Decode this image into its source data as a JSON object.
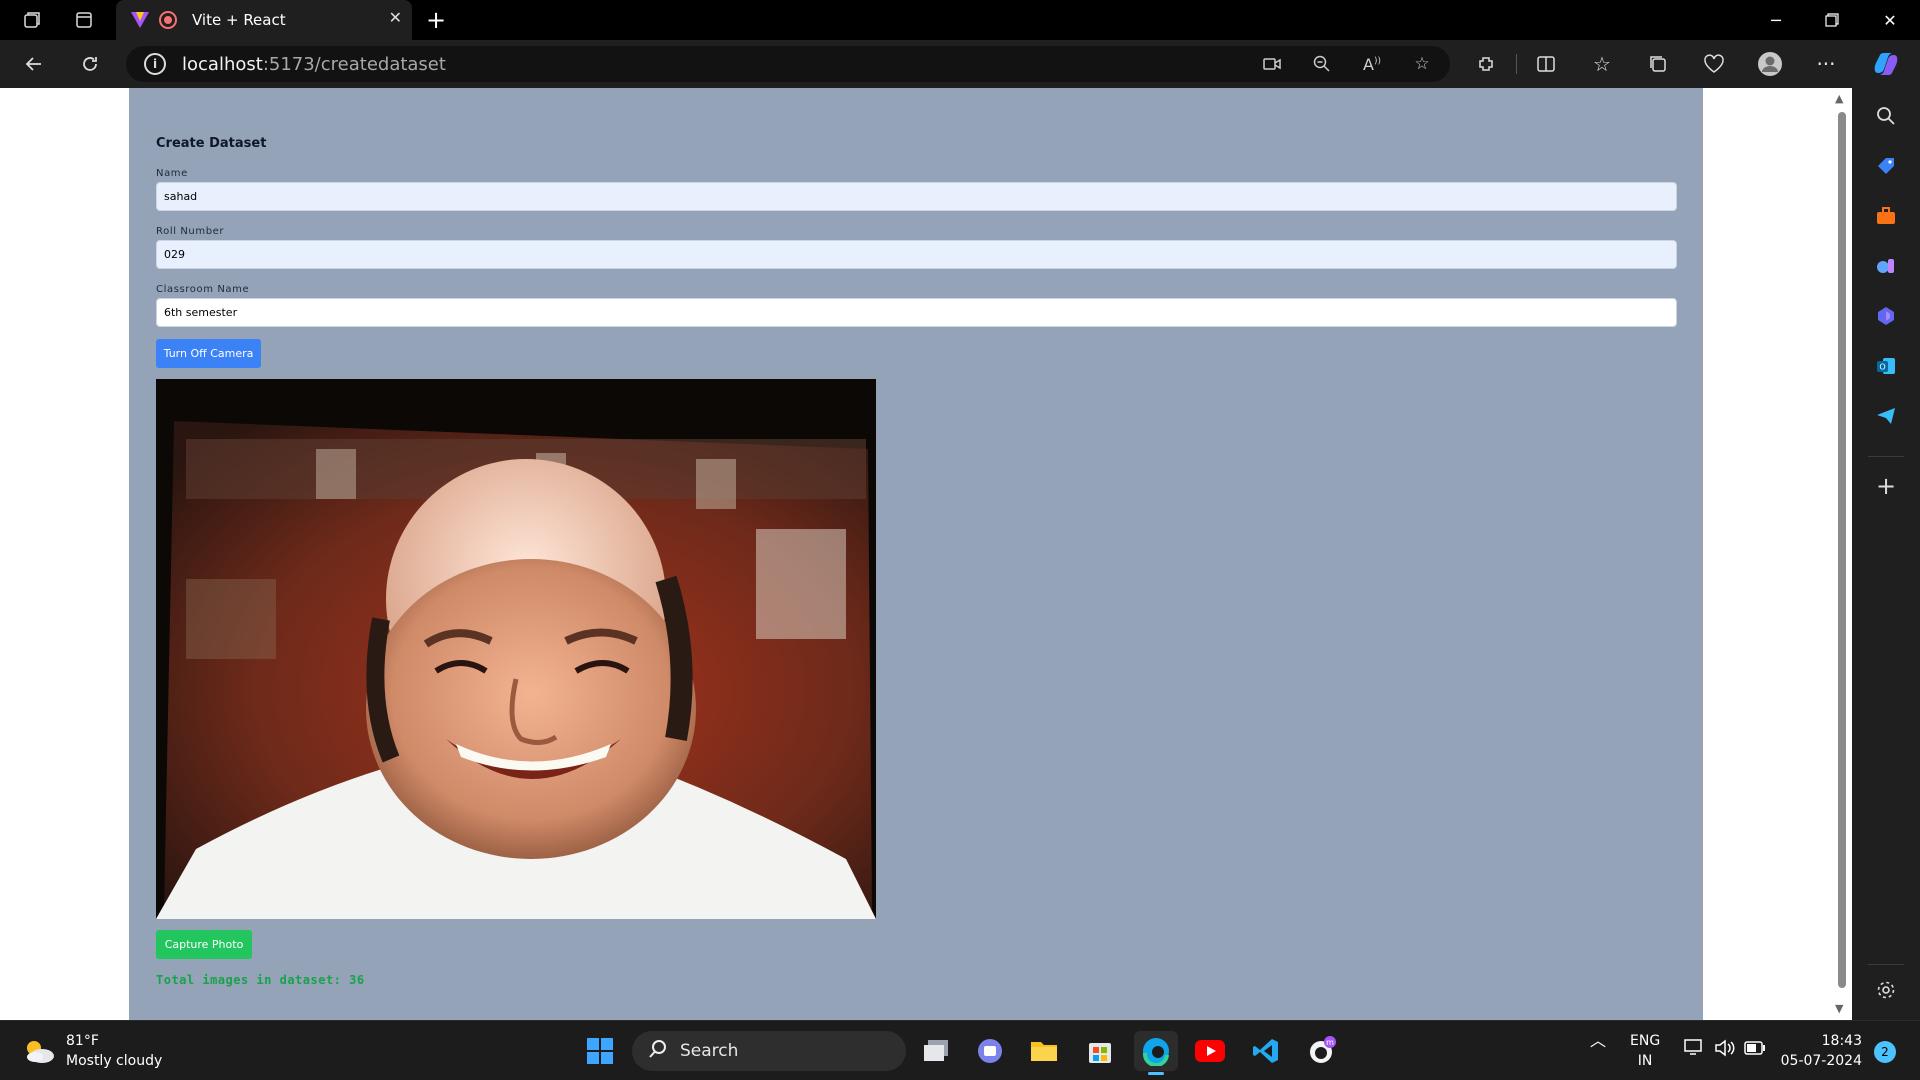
{
  "browser": {
    "tab_title": "Vite + React",
    "url_host": "localhost",
    "url_rest": ":5173/createdataset"
  },
  "page": {
    "heading": "Create Dataset",
    "name_label": "Name",
    "name_value": "sahad",
    "roll_label": "Roll Number",
    "roll_value": "029",
    "classroom_label": "Classroom Name",
    "classroom_value": "6th semester",
    "camera_button": "Turn Off Camera",
    "capture_button": "Capture Photo",
    "count_text": "Total images in dataset: 36"
  },
  "taskbar": {
    "temperature": "81°F",
    "weather": "Mostly cloudy",
    "search": "Search",
    "lang_top": "ENG",
    "lang_bottom": "IN",
    "time": "18:43",
    "date": "05-07-2024",
    "notifications": "2"
  },
  "colors": {
    "panel": "#94a3b8",
    "camera_button": "#3b82f6",
    "capture_button": "#22c55e",
    "count_text": "#16a34a"
  }
}
